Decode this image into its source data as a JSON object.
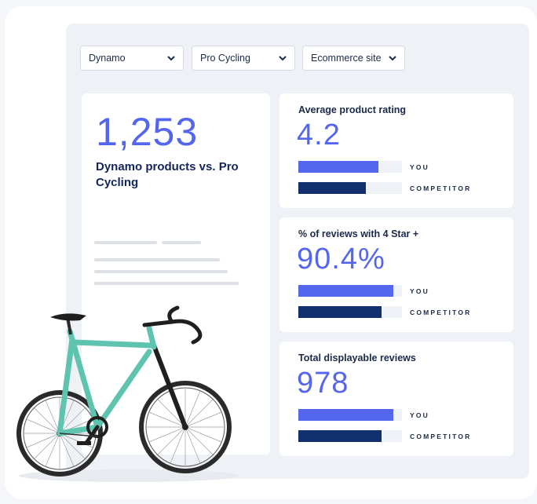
{
  "filters": {
    "brand": "Dynamo",
    "competitor": "Pro Cycling",
    "channel": "Ecommerce site"
  },
  "summary": {
    "count": "1,253",
    "description": "Dynamo products vs. Pro Cycling"
  },
  "metrics": [
    {
      "title": "Average product rating",
      "value": "4.2",
      "you_label": "YOU",
      "competitor_label": "COMPETITOR",
      "you_fill": 0.77,
      "competitor_fill": 0.65
    },
    {
      "title": "% of reviews with 4 Star +",
      "value": "90.4%",
      "you_label": "YOU",
      "competitor_label": "COMPETITOR",
      "you_fill": 0.92,
      "competitor_fill": 0.8
    },
    {
      "title": "Total displayable reviews",
      "value": "978",
      "you_label": "YOU",
      "competitor_label": "COMPETITOR",
      "you_fill": 0.92,
      "competitor_fill": 0.8
    }
  ],
  "colors": {
    "accent": "#5566ee",
    "navy": "#13306e",
    "bike_frame": "#5ec4b0"
  },
  "icons": {
    "dropdown": "chevron-down-icon",
    "illustration": "bicycle-illustration"
  }
}
